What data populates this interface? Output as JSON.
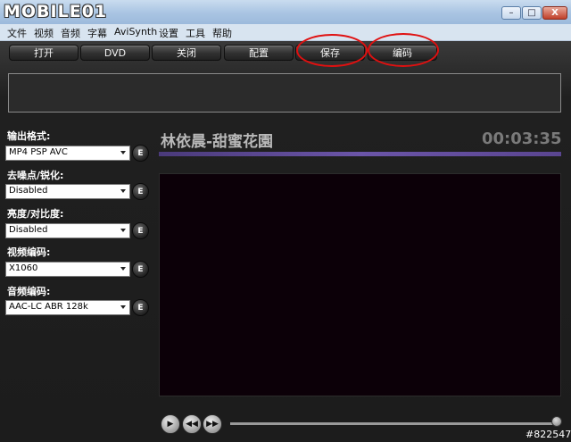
{
  "titlebar": {
    "logo": "MOBILE01",
    "min": "–",
    "max": "□",
    "close": "X"
  },
  "menu": [
    "文件",
    "视频",
    "音频",
    "字幕",
    "AviSynth",
    "设置",
    "工具",
    "帮助"
  ],
  "toolbar": {
    "open": "打开",
    "dvd": "DVD",
    "close": "关闭",
    "config": "配置",
    "save": "保存",
    "encode": "编码"
  },
  "settings": [
    {
      "label": "输出格式:",
      "value": "MP4 PSP AVC"
    },
    {
      "label": "去噪点/锐化:",
      "value": "Disabled"
    },
    {
      "label": "亮度/对比度:",
      "value": "Disabled"
    },
    {
      "label": "视频编码:",
      "value": "X1060"
    },
    {
      "label": "音频编码:",
      "value": "AAC-LC ABR 128k"
    }
  ],
  "edit_button": "E",
  "player": {
    "title": "林依晨-甜蜜花園",
    "time": "00:03:35",
    "play": "▶",
    "prev": "◀◀",
    "next": "▶▶",
    "seek_position": 0.98
  },
  "watermark": "#822547"
}
